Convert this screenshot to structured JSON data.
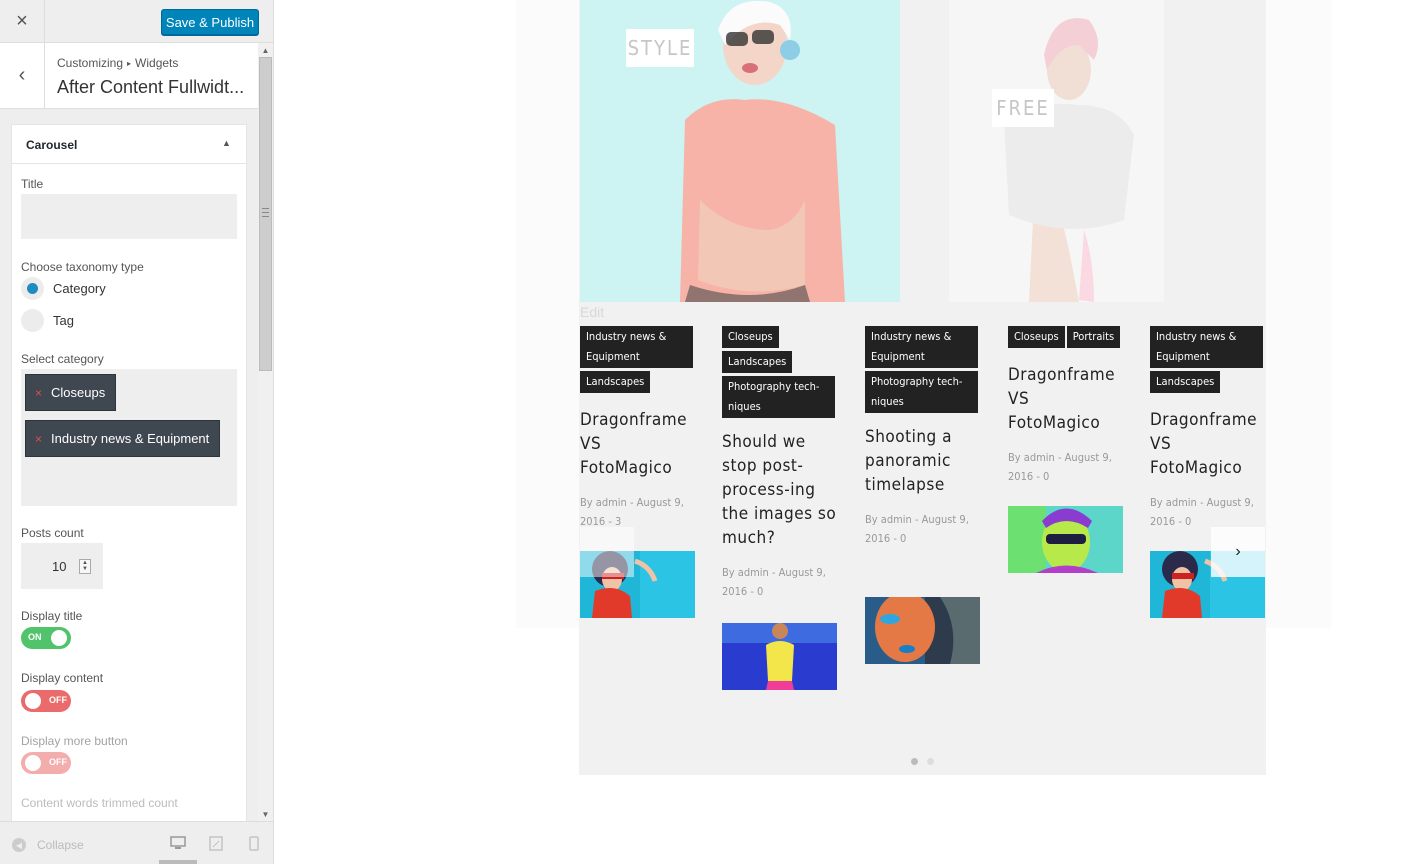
{
  "topbar": {
    "close_icon": "×",
    "save_label": "Save & Publish"
  },
  "section": {
    "back_icon": "‹",
    "crumb_root": "Customizing",
    "crumb_sep": "▸",
    "crumb_current": "Widgets",
    "title": "After Content Fullwidt..."
  },
  "widget": {
    "title": "Carousel",
    "toggle_icon": "▲",
    "fields": {
      "title_label": "Title",
      "title_value": "",
      "taxonomy_label": "Choose taxonomy type",
      "taxonomy_options": [
        "Category",
        "Tag"
      ],
      "taxonomy_selected": "Category",
      "category_label": "Select category",
      "categories_selected": [
        "Closeups",
        "Industry news & Equipment"
      ],
      "remove_icon": "×",
      "posts_count_label": "Posts count",
      "posts_count": "10",
      "display_title_label": "Display title",
      "display_title_state": "ON",
      "display_content_label": "Display content",
      "display_content_state": "OFF",
      "display_more_label": "Display more button",
      "display_more_state": "OFF",
      "trimmed_label": "Content words trimmed count"
    }
  },
  "footer": {
    "collapse_label": "Collapse",
    "collapse_icon": "◀",
    "devices": [
      "desktop-icon",
      "tablet-icon",
      "mobile-icon"
    ]
  },
  "preview": {
    "slides": [
      {
        "tag": "STYLE",
        "bg": "#cdf3f3"
      },
      {
        "tag": "FREE",
        "bg": "#f6f6f6"
      }
    ],
    "edit_link": "Edit",
    "posts": [
      {
        "tags": [
          "Industry news &\nEquipment",
          "Landscapes"
        ],
        "title": "Dragonframe VS FotoMagico",
        "meta": "By admin - August 9, 2016 - 3"
      },
      {
        "tags": [
          "Closeups",
          "Landscapes",
          "Photography tech-\nniques"
        ],
        "title": "Should we stop post-process-ing the images so much?",
        "meta": "By admin - August 9, 2016 - 0"
      },
      {
        "tags": [
          "Industry news &\nEquipment",
          "Photography tech-\nniques"
        ],
        "title": "Shooting a panoramic timelapse",
        "meta": "By admin - August 9, 2016 - 0"
      },
      {
        "tags": [
          "Closeups",
          "Portraits"
        ],
        "title": "Dragonframe VS FotoMagico",
        "meta": "By admin - August 9, 2016 - 0"
      },
      {
        "tags": [
          "Industry news &\nEquipment",
          "Landscapes"
        ],
        "title": "Dragonframe VS FotoMagico",
        "meta": "By admin - August 9, 2016 - 0"
      }
    ],
    "next_icon": "›",
    "pagination": {
      "pages": 2,
      "current": 1
    },
    "colors": {
      "accent": "#0085ba",
      "tag_bg": "#222222",
      "toggle_on": "#51c46b",
      "toggle_off": "#ea6b6b"
    }
  }
}
